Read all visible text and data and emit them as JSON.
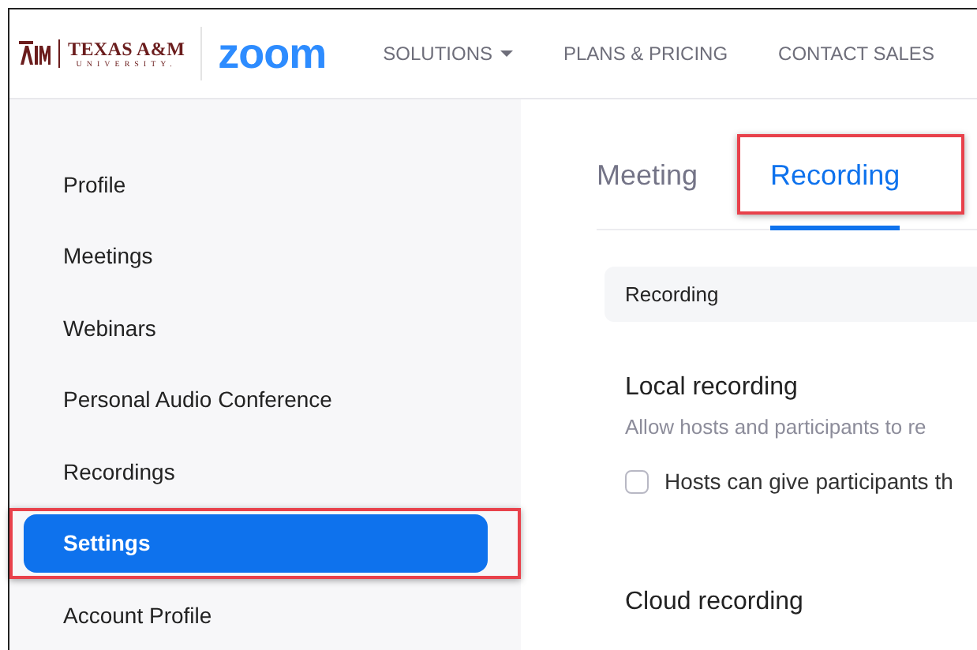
{
  "header": {
    "university": "TEXAS A&M",
    "university_sub": "UNIVERSITY.",
    "brand": "zoom",
    "nav": [
      {
        "label": "SOLUTIONS",
        "dropdown": true
      },
      {
        "label": "PLANS & PRICING",
        "dropdown": false
      },
      {
        "label": "CONTACT SALES",
        "dropdown": false
      }
    ]
  },
  "sidebar": {
    "items": [
      {
        "label": "Profile",
        "selected": false,
        "highlighted": false
      },
      {
        "label": "Meetings",
        "selected": false,
        "highlighted": false
      },
      {
        "label": "Webinars",
        "selected": false,
        "highlighted": false
      },
      {
        "label": "Personal Audio Conference",
        "selected": false,
        "highlighted": false
      },
      {
        "label": "Recordings",
        "selected": false,
        "highlighted": false
      },
      {
        "label": "Settings",
        "selected": true,
        "highlighted": true
      },
      {
        "label": "Account Profile",
        "selected": false,
        "highlighted": false
      }
    ]
  },
  "tabs": [
    {
      "label": "Meeting",
      "selected": false,
      "highlighted": false
    },
    {
      "label": "Recording",
      "selected": true,
      "highlighted": true
    }
  ],
  "section_bar": "Recording",
  "sections": [
    {
      "title": "Local recording",
      "description": "Allow hosts and participants to re",
      "options": [
        {
          "label": "Hosts can give participants th",
          "checked": false
        }
      ]
    },
    {
      "title": "Cloud recording"
    }
  ]
}
